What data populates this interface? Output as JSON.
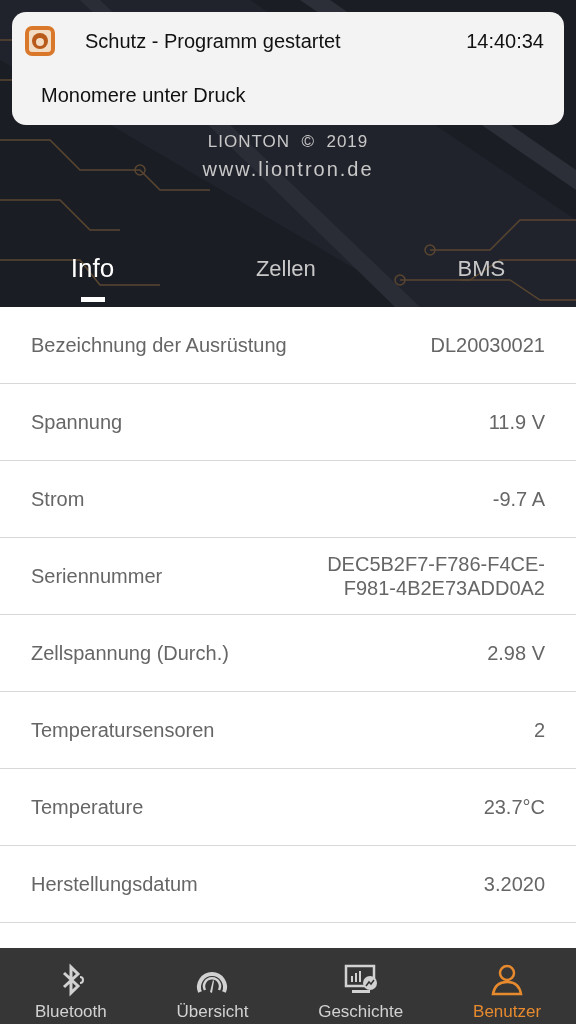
{
  "notification": {
    "title": "Schutz - Programm gestartet",
    "time": "14:40:34",
    "body": "Monomere unter Druck"
  },
  "header": {
    "copyright": "LIONTON  ©  2019",
    "website": "www.liontron.de"
  },
  "tabs": [
    {
      "label": "Info",
      "selected": true
    },
    {
      "label": "Zellen",
      "selected": false
    },
    {
      "label": "BMS",
      "selected": false
    }
  ],
  "rows": [
    {
      "label": "Bezeichnung der Ausrüstung",
      "value": "DL20030021"
    },
    {
      "label": "Spannung",
      "value": "11.9 V"
    },
    {
      "label": "Strom",
      "value": "-9.7 A"
    },
    {
      "label": "Seriennummer",
      "value": "DEC5B2F7-F786-F4CE-F981-4B2E73ADD0A2"
    },
    {
      "label": "Zellspannung (Durch.)",
      "value": "2.98 V"
    },
    {
      "label": "Temperatursensoren",
      "value": "2"
    },
    {
      "label": "Temperature",
      "value": "23.7°C"
    },
    {
      "label": "Herstellungsdatum",
      "value": "3.2020"
    }
  ],
  "tab_bar": [
    {
      "kind": "bluetooth",
      "label": "Bluetooth",
      "selected": false
    },
    {
      "kind": "gauge",
      "label": "Übersicht",
      "selected": false
    },
    {
      "kind": "history",
      "label": "Geschichte",
      "selected": false
    },
    {
      "kind": "user",
      "label": "Benutzer",
      "selected": true
    }
  ]
}
